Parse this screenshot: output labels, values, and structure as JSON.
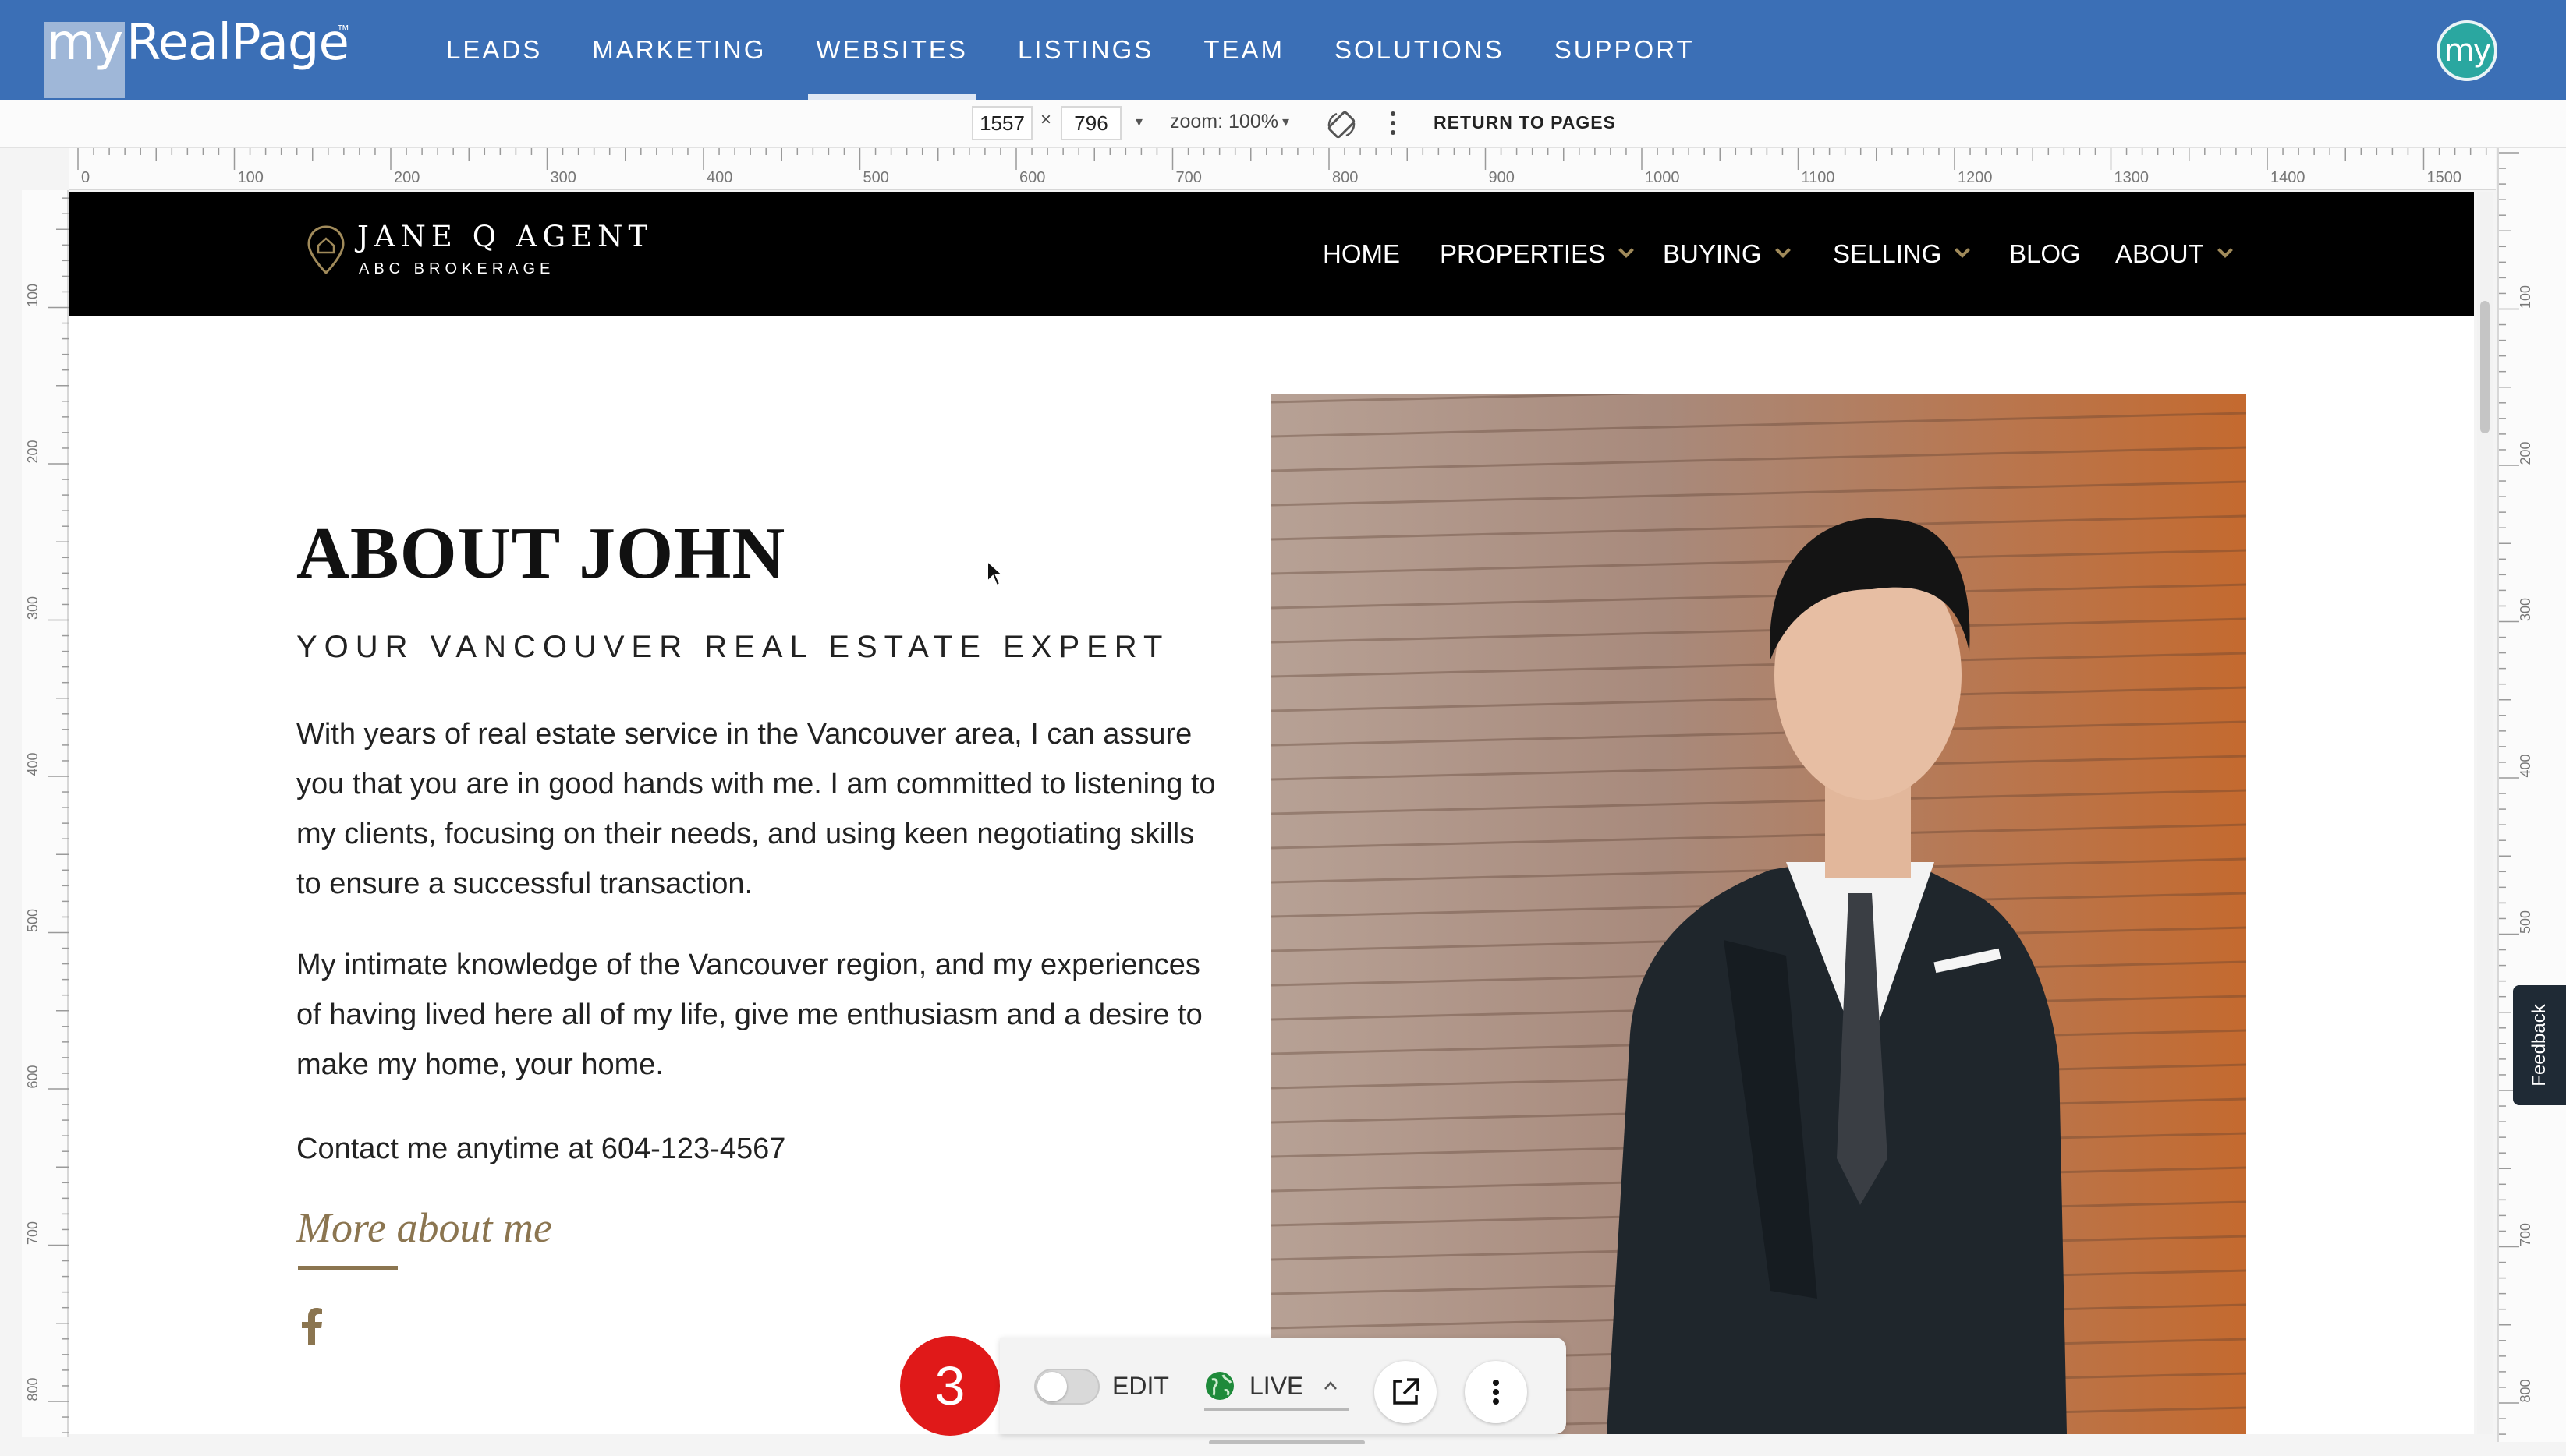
{
  "app": {
    "logo_my": "my",
    "logo_name": "RealPage",
    "logo_tm": "™",
    "nav": [
      {
        "label": "LEADS",
        "active": false
      },
      {
        "label": "MARKETING",
        "active": false
      },
      {
        "label": "WEBSITES",
        "active": true
      },
      {
        "label": "LISTINGS",
        "active": false
      },
      {
        "label": "TEAM",
        "active": false
      },
      {
        "label": "SOLUTIONS",
        "active": false
      },
      {
        "label": "SUPPORT",
        "active": false
      }
    ],
    "avatar_text": "my",
    "colors": {
      "app_bar": "#3b6fb6",
      "avatar": "#2aa7a0"
    }
  },
  "toolbar": {
    "width_value": "1557",
    "times": "×",
    "height_value": "796",
    "zoom_label": "zoom: 100%",
    "return_label": "RETURN TO PAGES"
  },
  "ruler": {
    "top_ticks": [
      "0",
      "100",
      "200",
      "300",
      "400",
      "500",
      "600",
      "700",
      "800",
      "900",
      "1000",
      "1100",
      "1200",
      "1300",
      "1400",
      "1500"
    ],
    "left_ticks": [
      "100",
      "200",
      "300",
      "400",
      "500",
      "600",
      "700",
      "800"
    ]
  },
  "site": {
    "brand_name": "JANE Q AGENT",
    "brand_sub": "ABC BROKERAGE",
    "nav": [
      {
        "label": "HOME",
        "dropdown": false
      },
      {
        "label": "PROPERTIES",
        "dropdown": true
      },
      {
        "label": "BUYING",
        "dropdown": true
      },
      {
        "label": "SELLING",
        "dropdown": true
      },
      {
        "label": "BLOG",
        "dropdown": false
      },
      {
        "label": "ABOUT",
        "dropdown": true
      }
    ],
    "about_title": "ABOUT JOHN",
    "about_subtitle": "YOUR VANCOUVER REAL ESTATE EXPERT",
    "paragraph_1": "With years of real estate service in the Vancouver area, I can assure you that you are in good hands with me. I am committed to listening to my clients, focusing on their needs, and using keen negotiating skills to ensure a successful transaction.",
    "paragraph_2": "My intimate knowledge of the Vancouver region, and my experiences of having lived here all of my life, give me enthusiasm and a desire to make my home, your home.",
    "paragraph_3": "Contact me anytime at 604-123-4567",
    "more_link": "More about me",
    "social_icon": "facebook-icon",
    "accent_color": "#8b7550"
  },
  "feedback_label": "Feedback",
  "bottom_bar": {
    "badge_count": "3",
    "edit_label": "EDIT",
    "edit_enabled": false,
    "live_label": "LIVE",
    "icons": [
      "globe-icon",
      "chevron-up-icon",
      "external-link-icon",
      "more-vertical-icon"
    ]
  }
}
